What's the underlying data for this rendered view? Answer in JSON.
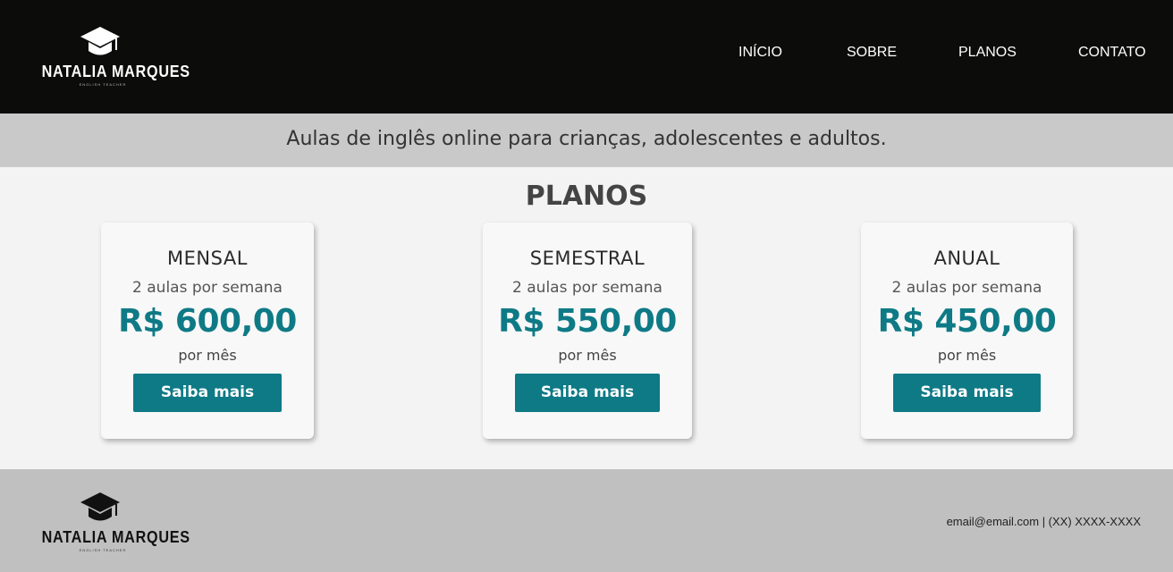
{
  "header": {
    "brand_name": "NATALIA MARQUES",
    "brand_tagline": "ENGLISH TEACHER",
    "nav": [
      "INÍCIO",
      "SOBRE",
      "PLANOS",
      "CONTATO"
    ]
  },
  "hero": {
    "tagline": "Aulas de inglês online para crianças, adolescentes e adultos."
  },
  "plans": {
    "title": "PLANOS",
    "items": [
      {
        "name": "MENSAL",
        "frequency": "2 aulas por semana",
        "price": "R$ 600,00",
        "period": "por mês",
        "cta": "Saiba mais"
      },
      {
        "name": "SEMESTRAL",
        "frequency": "2 aulas por semana",
        "price": "R$ 550,00",
        "period": "por mês",
        "cta": "Saiba mais"
      },
      {
        "name": "ANUAL",
        "frequency": "2 aulas por semana",
        "price": "R$ 450,00",
        "period": "por mês",
        "cta": "Saiba mais"
      }
    ]
  },
  "footer": {
    "brand_name": "NATALIA MARQUES",
    "brand_tagline": "ENGLISH TEACHER",
    "contact": "email@email.com | (XX) XXXX-XXXX"
  },
  "colors": {
    "header_bg": "#0c0c0b",
    "tagline_bg": "#c9c9c9",
    "accent": "#0e7a86",
    "footer_bg": "#c0c0c0"
  },
  "icons": {
    "logo": "graduation-cap-icon"
  }
}
